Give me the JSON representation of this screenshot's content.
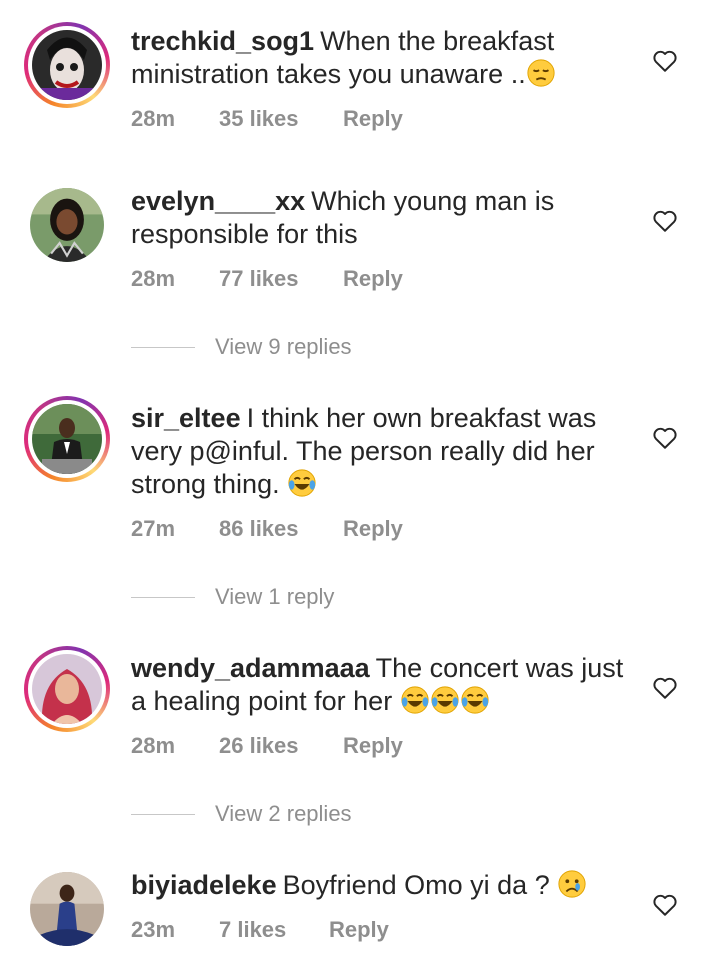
{
  "comments": [
    {
      "username": "trechkid_sog1",
      "text": "When the breakfast ministration takes you unaware ..",
      "emojis": [
        "pensive-face"
      ],
      "time": "28m",
      "likes": "35 likes",
      "reply": "Reply",
      "story_ring": true
    },
    {
      "username": "evelyn____xx",
      "text": "Which young man is responsible for this",
      "emojis": [],
      "time": "28m",
      "likes": "77 likes",
      "reply": "Reply",
      "story_ring": false,
      "view_replies": "View 9 replies"
    },
    {
      "username": "sir_eltee",
      "text": "I think her own breakfast was very p@inful. The person really did her strong thing.",
      "emojis": [
        "tears-of-joy"
      ],
      "time": "27m",
      "likes": "86 likes",
      "reply": "Reply",
      "story_ring": true,
      "view_replies": "View 1 reply"
    },
    {
      "username": "wendy_adammaaa",
      "text": "The concert was just a healing point for her",
      "emojis": [
        "tears-of-joy",
        "tears-of-joy",
        "tears-of-joy"
      ],
      "time": "28m",
      "likes": "26 likes",
      "reply": "Reply",
      "story_ring": true,
      "view_replies": "View 2 replies"
    },
    {
      "username": "biyiadeleke",
      "text": "Boyfriend Omo yi da ?",
      "emojis": [
        "crying-face"
      ],
      "time": "23m",
      "likes": "7 likes",
      "reply": "Reply",
      "story_ring": false
    }
  ],
  "colors": {
    "text": "#262626",
    "meta": "#8e8e8e",
    "divider": "#c7c7c7"
  },
  "icons": {
    "like": "heart-outline-icon"
  }
}
